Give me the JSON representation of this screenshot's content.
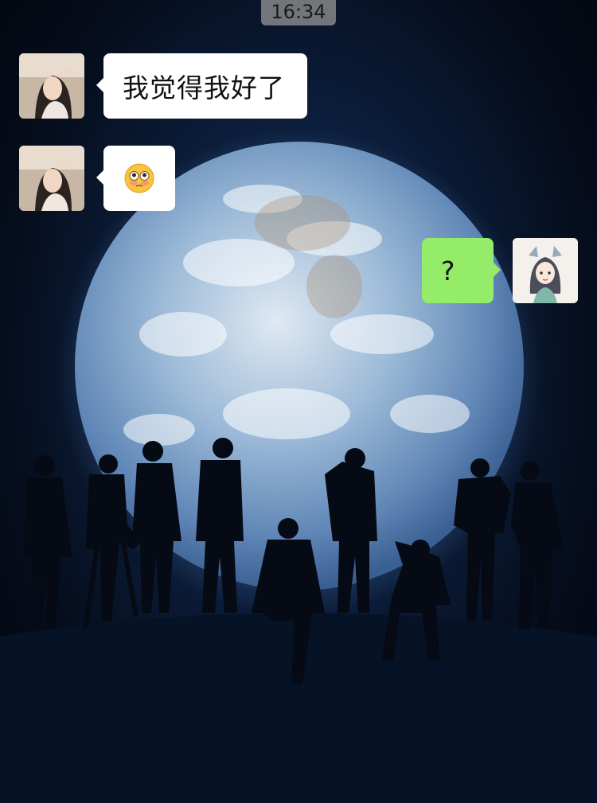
{
  "status": {
    "time": "16:34"
  },
  "messages": [
    {
      "side": "left",
      "sender_avatar": "woman-avatar",
      "text": "我觉得我好了"
    },
    {
      "side": "left",
      "sender_avatar": "woman-avatar",
      "emoji": "flushed-face-emoji"
    },
    {
      "side": "right",
      "sender_avatar": "anime-girl-avatar",
      "text": "?"
    }
  ],
  "colors": {
    "incoming_bubble": "#ffffff",
    "outgoing_bubble": "#95ec69",
    "background": "#050b18"
  }
}
